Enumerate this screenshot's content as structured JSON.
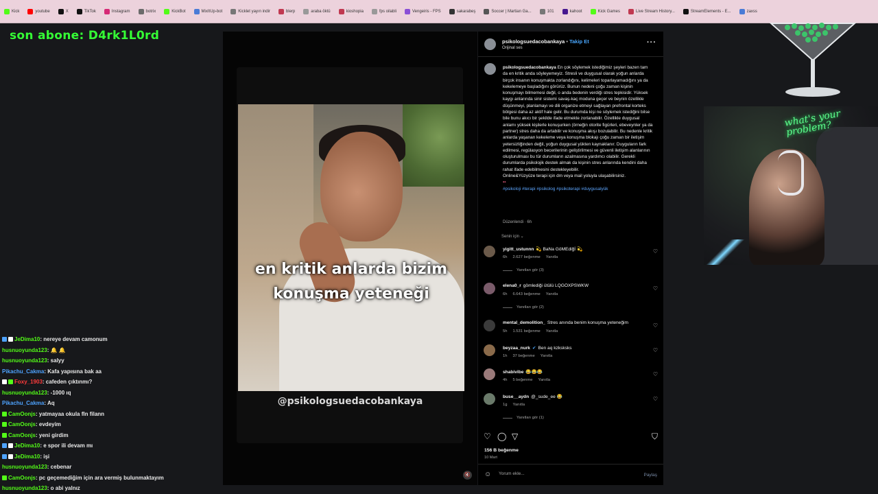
{
  "bookmarks": [
    {
      "label": "Kick",
      "color": "#53fc18"
    },
    {
      "label": "youtube",
      "color": "#ff0000"
    },
    {
      "label": "X",
      "color": "#111111"
    },
    {
      "label": "TikTok",
      "color": "#111111"
    },
    {
      "label": "Instagram",
      "color": "#d62976"
    },
    {
      "label": "botrix",
      "color": "#6b6b6b"
    },
    {
      "label": "KickBot",
      "color": "#53fc18"
    },
    {
      "label": "MixItUp-bot",
      "color": "#4a7bd6"
    },
    {
      "label": "Kicklet yayın indir",
      "color": "#777777"
    },
    {
      "label": "blerp",
      "color": "#c03850"
    },
    {
      "label": "araba öktü",
      "color": "#999999"
    },
    {
      "label": "kioshopia",
      "color": "#c03850"
    },
    {
      "label": "fps oilabli",
      "color": "#999999"
    },
    {
      "label": "Vengeiris - FPS",
      "color": "#8a4fd6"
    },
    {
      "label": "sakarabeş",
      "color": "#333333"
    },
    {
      "label": "Soccer | Martian Ga...",
      "color": "#555555"
    },
    {
      "label": "101",
      "color": "#777777"
    },
    {
      "label": "kahoot",
      "color": "#46178f"
    },
    {
      "label": "Kick Games",
      "color": "#53fc18"
    },
    {
      "label": "Live Stream History...",
      "color": "#c03850"
    },
    {
      "label": "StreamElements - E...",
      "color": "#111111"
    },
    {
      "label": "zaxss",
      "color": "#4a7bd6"
    }
  ],
  "alert": {
    "text": "son abone: D4rk1L0rd"
  },
  "chat": [
    {
      "user": "JeDima10",
      "color": "#53fc18",
      "badges": [
        "#4ea3ff",
        "#ffffff"
      ],
      "text": ": nereye devam camonum"
    },
    {
      "user": "husnuoyunda123",
      "color": "#53fc18",
      "badges": [],
      "text": ": 🔔 🔔"
    },
    {
      "user": "husnuoyunda123",
      "color": "#53fc18",
      "badges": [],
      "text": ": salyy"
    },
    {
      "user": "Pikachu_Cakma",
      "color": "#4ea3ff",
      "badges": [],
      "text": ": Kafa yapısına bak aa"
    },
    {
      "user": "Foxy_1903",
      "color": "#ff3b3b",
      "badges": [
        "#ffffff",
        "#53fc18"
      ],
      "text": ": cafeden çıktınmı?"
    },
    {
      "user": "husnuoyunda123",
      "color": "#53fc18",
      "badges": [],
      "text": ": -1000 ıq"
    },
    {
      "user": "Pikachu_Cakma",
      "color": "#4ea3ff",
      "badges": [],
      "text": ": Aq"
    },
    {
      "user": "CamOonjs",
      "color": "#53fc18",
      "badges": [
        "#53fc18"
      ],
      "text": ": yatmayaa okula fln filann"
    },
    {
      "user": "CamOonjs",
      "color": "#53fc18",
      "badges": [
        "#53fc18"
      ],
      "text": ": evdeyim"
    },
    {
      "user": "CamOonjs",
      "color": "#53fc18",
      "badges": [
        "#53fc18"
      ],
      "text": ": yeni girdim"
    },
    {
      "user": "JeDima10",
      "color": "#53fc18",
      "badges": [
        "#4ea3ff",
        "#ffffff"
      ],
      "text": ": e spor ili devam mı"
    },
    {
      "user": "JeDima10",
      "color": "#53fc18",
      "badges": [
        "#4ea3ff",
        "#ffffff"
      ],
      "text": ": işi"
    },
    {
      "user": "husnuoyunda123",
      "color": "#53fc18",
      "badges": [],
      "text": ": cebenar"
    },
    {
      "user": "CamOonjs",
      "color": "#53fc18",
      "badges": [
        "#53fc18"
      ],
      "text": ": pc geçemediğim için ara vermiş bulunmaktayım"
    },
    {
      "user": "husnuoyunda123",
      "color": "#53fc18",
      "badges": [],
      "text": ": o abi yalnız"
    }
  ],
  "video": {
    "subtitle_line1": "en kritik anlarda bizim",
    "subtitle_line2": "konuşma yeteneği",
    "watermark": "@psikologsuedacobankaya"
  },
  "post": {
    "username": "psikologsuedacobankaya",
    "follow": "Takip Et",
    "audio": "Orijinal ses",
    "caption_user": "psikologsuedacobankaya",
    "caption": "En çok söylemek istediğimiz şeyleri bazen tam da en kritik anda söyleyemeyiz. Stresli ve duygusal olarak yoğun anlarda birçok insanın konuşmakta zorlandığını, kelimeleri toparlayamadığını ya da kekelemeye başladığını görürüz. Bunun nedeni çoğu zaman kişinin konuşmayı bilmemesi değil, o anda bedenin verdiği stres tepkisidir. Yüksek kaygı anlarında sinir sistemi savaş-kaç moduna geçer ve beynin özellikle düşünmeyi, planlamayı ve dili organize etmeyi sağlayan prefrontal korteks bölgesi daha az aktif hale gelir. Bu durumda kişi ne söylemek istediğini bilse bile bunu akıcı bir şekilde ifade etmekte zorlanabilir. Özellikle duygusal anlamı yüksek kişilerle konuşurken (örneğin otorite figürleri, ebeveynler ya da partner) stres daha da artabilir ve konuşma akışı bozulabilir. Bu nedenle kritik anlarda yaşanan kekeleme veya konuşma blokajı çoğu zaman bir iletişim yetersizliğinden değil, yoğun duygusal yükten kaynaklanır. Duyguların fark edilmesi, regülasyon becerilerinin geliştirilmesi ve güvenli iletişim alanlarının oluşturulması bu tür durumların azalmasına yardımcı olabilir. Gerekli durumlarda psikolojik destek almak da kişinin stres anlarında kendini daha rahat ifade edebilmesini destekleyebilir.",
    "caption_contact": "Online&Yüzyüze terapi için dm veya mail yoluyla ulaşabilirsiniz.",
    "tags": "#psikoloji #terapi #psikolog #psikoterapi #duygusalyük",
    "edited": "Düzenlendi · 6h",
    "for_you": "Senin için ⌄",
    "likes": "156 B beğenme",
    "date": "10 Mart",
    "compose_placeholder": "Yorum ekle...",
    "share": "Paylaş"
  },
  "comments": [
    {
      "user": "yigitt_ustunnn",
      "text": "💫 BaNa GöMEdiğİ 💫",
      "time": "6h",
      "likes": "2.627 beğenme",
      "reply": "Yanıtla",
      "replies": "Yanıtları gör (3)",
      "avatar": "#6b5a4a"
    },
    {
      "user": "elena0_r",
      "text": "gömlediği ütülü LQĞÖXPSWKW",
      "time": "6h",
      "likes": "6.643 beğenme",
      "reply": "Yanıtla",
      "replies": "Yanıtları gör (2)",
      "avatar": "#7a5b6a"
    },
    {
      "user": "mental_demolition_",
      "text": "Stres anında benim konuşma yeteneğim",
      "time": "5h",
      "likes": "1.531 beğenme",
      "reply": "Yanıtla",
      "replies": "",
      "avatar": "#3a3a3a"
    },
    {
      "user": "beyzaa_nurk",
      "text": "Ben aq kzksksks",
      "time": "1h",
      "likes": "37 beğenme",
      "reply": "Yanıtla",
      "replies": "",
      "avatar": "#8a6a4a",
      "verified": "✔"
    },
    {
      "user": "shabivibe",
      "text": "😂😂😂",
      "time": "4h",
      "likes": "5 beğenme",
      "reply": "Yanıtla",
      "replies": "",
      "avatar": "#9a7a7a"
    },
    {
      "user": "buse__aydn",
      "text": "@_sude_ee 😂",
      "time": "1g",
      "likes": "",
      "reply": "Yanıtla",
      "replies": "Yanıtları gör (1)",
      "avatar": "#6a7a6a"
    }
  ],
  "cam": {
    "neon": "what's your problem?"
  }
}
